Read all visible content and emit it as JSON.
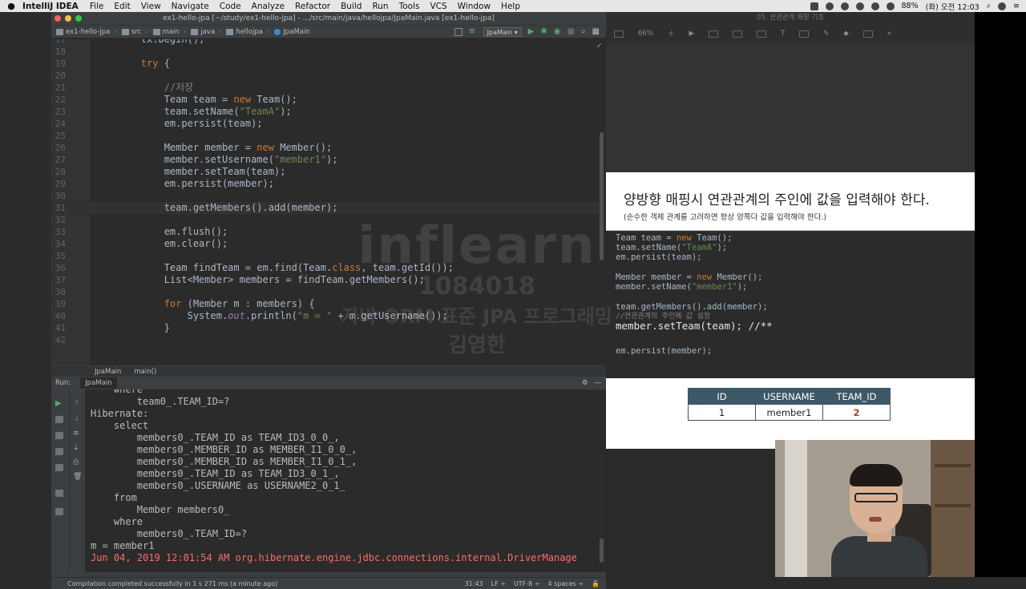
{
  "menubar": {
    "app": "IntelliJ IDEA",
    "items": [
      "File",
      "Edit",
      "View",
      "Navigate",
      "Code",
      "Analyze",
      "Refactor",
      "Build",
      "Run",
      "Tools",
      "VCS",
      "Window",
      "Help"
    ],
    "battery": "88%",
    "clock": "(화) 오전 12:03"
  },
  "ide": {
    "window_title": "ex1-hello-jpa [~/study/ex1-hello-jpa] - .../src/main/java/hellojpa/JpaMain.java [ex1-hello-jpa]",
    "nav": [
      "ex1-hello-jpa",
      "src",
      "main",
      "java",
      "hellojpa",
      "JpaMain"
    ],
    "run_config": "JpaMain",
    "code_lines": [
      {
        "n": "17",
        "text": "        tx.begin();"
      },
      {
        "n": "18",
        "text": ""
      },
      {
        "n": "19",
        "text": "        try {"
      },
      {
        "n": "20",
        "text": ""
      },
      {
        "n": "21",
        "text": "            //저장"
      },
      {
        "n": "22",
        "text": "            Team team = new Team();"
      },
      {
        "n": "23",
        "text": "            team.setName(\"TeamA\");"
      },
      {
        "n": "24",
        "text": "            em.persist(team);"
      },
      {
        "n": "25",
        "text": ""
      },
      {
        "n": "26",
        "text": "            Member member = new Member();"
      },
      {
        "n": "27",
        "text": "            member.setUsername(\"member1\");"
      },
      {
        "n": "28",
        "text": "            member.setTeam(team);"
      },
      {
        "n": "29",
        "text": "            em.persist(member);"
      },
      {
        "n": "30",
        "text": ""
      },
      {
        "n": "31",
        "text": "            team.getMembers().add(member);"
      },
      {
        "n": "32",
        "text": ""
      },
      {
        "n": "33",
        "text": "            em.flush();"
      },
      {
        "n": "34",
        "text": "            em.clear();"
      },
      {
        "n": "35",
        "text": ""
      },
      {
        "n": "36",
        "text": "            Team findTeam = em.find(Team.class, team.getId());"
      },
      {
        "n": "37",
        "text": "            List<Member> members = findTeam.getMembers();"
      },
      {
        "n": "38",
        "text": ""
      },
      {
        "n": "39",
        "text": "            for (Member m : members) {"
      },
      {
        "n": "40",
        "text": "                System.out.println(\"m = \" + m.getUsername());"
      },
      {
        "n": "41",
        "text": "            }"
      },
      {
        "n": "42",
        "text": ""
      }
    ],
    "breadcrumb": [
      "JpaMain",
      "main()"
    ],
    "run_label": "Run:",
    "run_tab": "JpaMain",
    "console_lines": [
      {
        "text": "    where",
        "err": false
      },
      {
        "text": "        team0_.TEAM_ID=?",
        "err": false
      },
      {
        "text": "Hibernate: ",
        "err": false
      },
      {
        "text": "    select",
        "err": false
      },
      {
        "text": "        members0_.TEAM_ID as TEAM_ID3_0_0_,",
        "err": false
      },
      {
        "text": "        members0_.MEMBER_ID as MEMBER_I1_0_0_,",
        "err": false
      },
      {
        "text": "        members0_.MEMBER_ID as MEMBER_I1_0_1_,",
        "err": false
      },
      {
        "text": "        members0_.TEAM_ID as TEAM_ID3_0_1_,",
        "err": false
      },
      {
        "text": "        members0_.USERNAME as USERNAME2_0_1_ ",
        "err": false
      },
      {
        "text": "    from",
        "err": false
      },
      {
        "text": "        Member members0_ ",
        "err": false
      },
      {
        "text": "    where",
        "err": false
      },
      {
        "text": "        members0_.TEAM_ID=?",
        "err": false
      },
      {
        "text": "m = member1",
        "err": false
      },
      {
        "text": "Jun 04, 2019 12:01:54 AM org.hibernate.engine.jdbc.connections.internal.DriverManage",
        "err": true
      }
    ],
    "status_message": "Compilation completed successfully in 1 s 271 ms (a minute ago)",
    "status_pos": "31:43",
    "status_lf": "LF ÷",
    "status_enc": "UTF-8 ÷",
    "status_indent": "4 spaces ÷"
  },
  "slide": {
    "window_title": "05. 연관관계 매핑 기초",
    "zoom": "66%",
    "heading": "양방향 매핑시 연관관계의 주인에 값을 입력해야 한다.",
    "subheading": "(순수한 객체 관계를 고려하면 항상 양쪽다 값을 입력해야 한다.)",
    "code": [
      "Team team = new Team();",
      "team.setName(\"TeamA\");",
      "em.persist(team);",
      "",
      "Member member = new Member();",
      "member.setName(\"member1\");",
      "",
      "team.getMembers().add(member);",
      "//연관관계의 주인에 값 설정",
      "member.setTeam(team); //**",
      "",
      "em.persist(member);"
    ],
    "table": {
      "headers": [
        "ID",
        "USERNAME",
        "TEAM_ID"
      ],
      "row": [
        "1",
        "member1",
        "2"
      ]
    }
  },
  "watermark": {
    "logo": "inflearn",
    "number": "1084018",
    "course": "자바 ORM 표준 JPA 프로그래밍",
    "author": "김영한"
  },
  "colors": {
    "editor_bg": "#2b2b2b",
    "keyword": "#cc7832",
    "string": "#6a8759",
    "table_header": "#3d5866",
    "error": "#ff6b68"
  }
}
